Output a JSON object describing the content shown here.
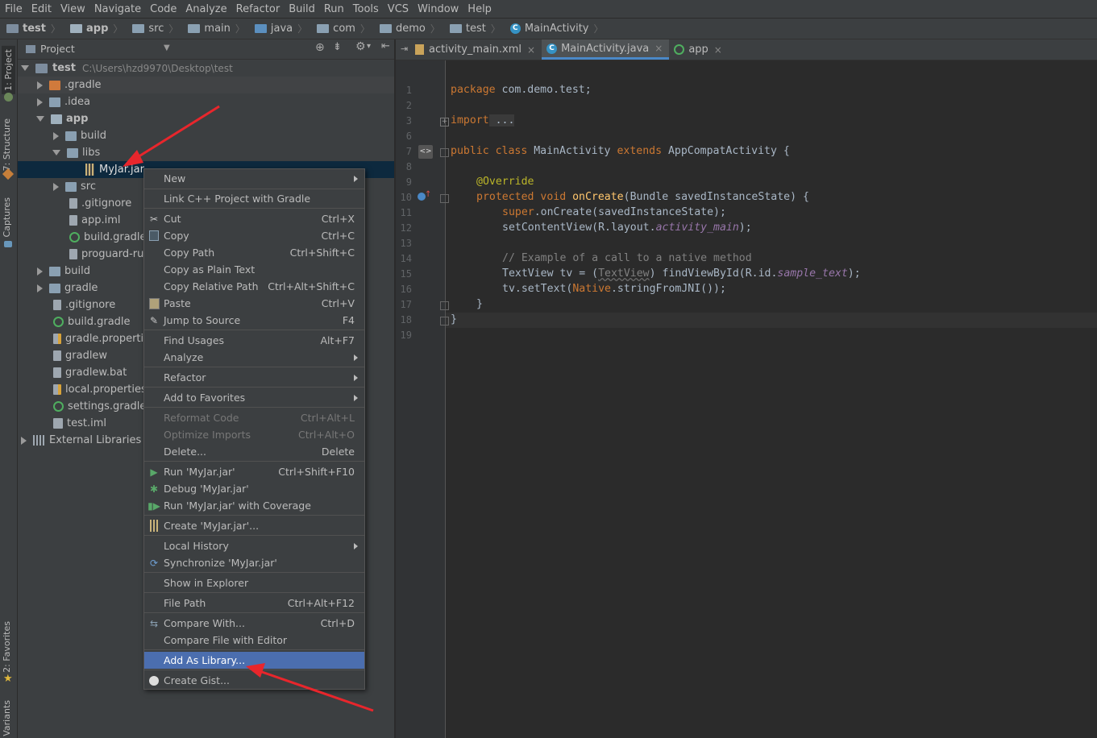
{
  "menubar": [
    "File",
    "Edit",
    "View",
    "Navigate",
    "Code",
    "Analyze",
    "Refactor",
    "Build",
    "Run",
    "Tools",
    "VCS",
    "Window",
    "Help"
  ],
  "breadcrumbs": [
    "test",
    "app",
    "src",
    "main",
    "java",
    "com",
    "demo",
    "test",
    "MainActivity"
  ],
  "side_tabs": {
    "project": "1: Project",
    "structure": "7: Structure",
    "captures": "Captures",
    "favorites": "2: Favorites",
    "variants": "Variants"
  },
  "project_panel": {
    "title": "Project"
  },
  "tree": {
    "root_name": "test",
    "root_path": "C:\\Users\\hzd9970\\Desktop\\test",
    "gradle_dir": ".gradle",
    "idea": ".idea",
    "app": "app",
    "build": "build",
    "libs": "libs",
    "jar": "MyJar.jar",
    "src": "src",
    "app_gitignore": ".gitignore",
    "app_iml": "app.iml",
    "app_build_gradle": "build.gradle",
    "proguard": "proguard-rul",
    "root_build": "build",
    "gradle": "gradle",
    "gitignore": ".gitignore",
    "build_gradle": "build.gradle",
    "gradle_properties": "gradle.propertie",
    "gradlew": "gradlew",
    "gradlew_bat": "gradlew.bat",
    "local_properties": "local.properties",
    "settings_gradle": "settings.gradle",
    "test_iml": "test.iml",
    "external_libraries": "External Libraries"
  },
  "editor_tabs": [
    "activity_main.xml",
    "MainActivity.java",
    "app"
  ],
  "line_numbers": [
    "1",
    "2",
    "3",
    "6",
    "7",
    "8",
    "9",
    "10",
    "11",
    "12",
    "13",
    "14",
    "15",
    "16",
    "17",
    "18",
    "19"
  ],
  "code": {
    "l1a": "package",
    "l1b": " com.demo.test;",
    "l3a": "import",
    "l3b": " ...",
    "l7a": "public class",
    "l7b": " MainActivity ",
    "l7c": "extends",
    "l7d": " AppCompatActivity {",
    "l9": "@Override",
    "l10a": "protected void",
    "l10b": "onCreate",
    "l10c": "(Bundle savedInstanceState) {",
    "l11a": "super",
    "l11b": ".onCreate(savedInstanceState);",
    "l12a": "setContentView(R.layout.",
    "l12b": "activity_main",
    "l12c": ");",
    "l14": "// Example of a call to a native method",
    "l15a": "TextView tv = (",
    "l15b": "TextView",
    "l15c": ") findViewById(R.id.",
    "l15d": "sample_text",
    "l15e": ");",
    "l16a": "tv.setText(",
    "l16b": "Native",
    "l16c": ".stringFromJNI());",
    "l17": "}",
    "l18": "}"
  },
  "context_menu": [
    {
      "label": "New",
      "shortcut": "",
      "submenu": true
    },
    {
      "label": "Link C++ Project with Gradle",
      "shortcut": ""
    },
    {
      "label": "Cut",
      "shortcut": "Ctrl+X",
      "icon": "scissors-icon"
    },
    {
      "label": "Copy",
      "shortcut": "Ctrl+C",
      "icon": "copy-icon"
    },
    {
      "label": "Copy Path",
      "shortcut": "Ctrl+Shift+C"
    },
    {
      "label": "Copy as Plain Text",
      "shortcut": ""
    },
    {
      "label": "Copy Relative Path",
      "shortcut": "Ctrl+Alt+Shift+C"
    },
    {
      "label": "Paste",
      "shortcut": "Ctrl+V",
      "icon": "paste-icon"
    },
    {
      "label": "Jump to Source",
      "shortcut": "F4",
      "icon": "jump-icon"
    },
    {
      "label": "Find Usages",
      "shortcut": "Alt+F7"
    },
    {
      "label": "Analyze",
      "shortcut": "",
      "submenu": true
    },
    {
      "label": "Refactor",
      "shortcut": "",
      "submenu": true
    },
    {
      "label": "Add to Favorites",
      "shortcut": "",
      "submenu": true
    },
    {
      "label": "Reformat Code",
      "shortcut": "Ctrl+Alt+L",
      "disabled": true
    },
    {
      "label": "Optimize Imports",
      "shortcut": "Ctrl+Alt+O",
      "disabled": true
    },
    {
      "label": "Delete...",
      "shortcut": "Delete"
    },
    {
      "label": "Run 'MyJar.jar'",
      "shortcut": "Ctrl+Shift+F10",
      "icon": "run-icon"
    },
    {
      "label": "Debug 'MyJar.jar'",
      "shortcut": "",
      "icon": "debug-icon"
    },
    {
      "label": "Run 'MyJar.jar' with Coverage",
      "shortcut": "",
      "icon": "coverage-icon"
    },
    {
      "label": "Create 'MyJar.jar'...",
      "shortcut": "",
      "icon": "jar-icon"
    },
    {
      "label": "Local History",
      "shortcut": "",
      "submenu": true
    },
    {
      "label": "Synchronize 'MyJar.jar'",
      "shortcut": "",
      "icon": "sync-icon"
    },
    {
      "label": "Show in Explorer",
      "shortcut": ""
    },
    {
      "label": "File Path",
      "shortcut": "Ctrl+Alt+F12"
    },
    {
      "label": "Compare With...",
      "shortcut": "Ctrl+D",
      "icon": "compare-icon"
    },
    {
      "label": "Compare File with Editor",
      "shortcut": ""
    },
    {
      "label": "Add As Library...",
      "shortcut": "",
      "selected": true
    },
    {
      "label": "Create Gist...",
      "shortcut": "",
      "icon": "github-icon"
    }
  ],
  "colors": {
    "accent": "#4b6eaf",
    "annotation_arrow": "#e8262c"
  }
}
